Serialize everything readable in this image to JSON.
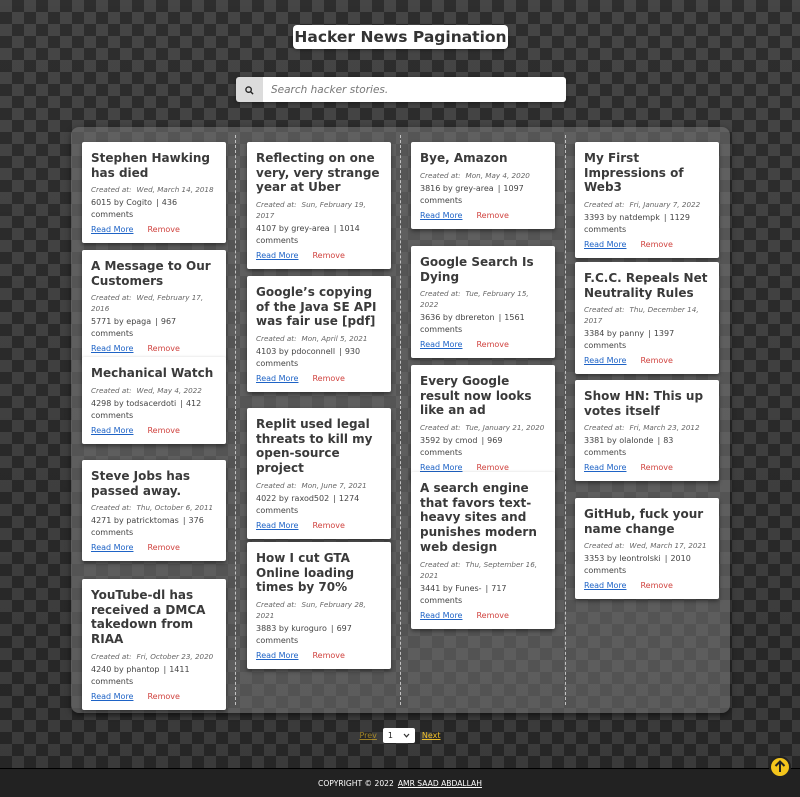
{
  "header": {
    "title": "Hacker News Pagination"
  },
  "search": {
    "placeholder": "Search hacker stories.",
    "icon": "search-icon"
  },
  "labels": {
    "created_at": "Created at:",
    "by": "by",
    "comments": "comments",
    "read_more": "Read More",
    "remove": "Remove"
  },
  "columns": [
    [
      {
        "title": "Stephen Hawking has died",
        "date": "Wed, March 14, 2018",
        "points": "6015",
        "author": "Cogito",
        "comments": "436"
      },
      {
        "title": "A Message to Our Customers",
        "date": "Wed, February 17, 2016",
        "points": "5771",
        "author": "epaga",
        "comments": "967"
      },
      {
        "title": "Mechanical Watch",
        "date": "Wed, May 4, 2022",
        "points": "4298",
        "author": "todsacerdoti",
        "comments": "412"
      },
      {
        "title": "Steve Jobs has passed away.",
        "date": "Thu, October 6, 2011",
        "points": "4271",
        "author": "patricktomas",
        "comments": "376"
      },
      {
        "title": "YouTube-dl has received a DMCA takedown from RIAA",
        "date": "Fri, October 23, 2020",
        "points": "4240",
        "author": "phantop",
        "comments": "1411"
      }
    ],
    [
      {
        "title": "Reflecting on one very, very strange year at Uber",
        "date": "Sun, February 19, 2017",
        "points": "4107",
        "author": "grey-area",
        "comments": "1014"
      },
      {
        "title": "Google’s copying of the Java SE API was fair use [pdf]",
        "date": "Mon, April 5, 2021",
        "points": "4103",
        "author": "pdoconnell",
        "comments": "930"
      },
      {
        "title": "Replit used legal threats to kill my open-source project",
        "date": "Mon, June 7, 2021",
        "points": "4022",
        "author": "raxod502",
        "comments": "1274"
      },
      {
        "title": "How I cut GTA Online loading times by 70%",
        "date": "Sun, February 28, 2021",
        "points": "3883",
        "author": "kuroguro",
        "comments": "697"
      }
    ],
    [
      {
        "title": "Bye, Amazon",
        "date": "Mon, May 4, 2020",
        "points": "3816",
        "author": "grey-area",
        "comments": "1097"
      },
      {
        "title": "Google Search Is Dying",
        "date": "Tue, February 15, 2022",
        "points": "3636",
        "author": "dbrereton",
        "comments": "1561"
      },
      {
        "title": "Every Google result now looks like an ad",
        "date": "Tue, January 21, 2020",
        "points": "3592",
        "author": "cmod",
        "comments": "969"
      },
      {
        "title": "A search engine that favors text-heavy sites and punishes modern web design",
        "date": "Thu, September 16, 2021",
        "points": "3441",
        "author": "Funes-",
        "comments": "717"
      }
    ],
    [
      {
        "title": "My First Impressions of Web3",
        "date": "Fri, January 7, 2022",
        "points": "3393",
        "author": "natdempk",
        "comments": "1129"
      },
      {
        "title": "F.C.C. Repeals Net Neutrality Rules",
        "date": "Thu, December 14, 2017",
        "points": "3384",
        "author": "panny",
        "comments": "1397"
      },
      {
        "title": "Show HN: This up votes itself",
        "date": "Fri, March 23, 2012",
        "points": "3381",
        "author": "olalonde",
        "comments": "83"
      },
      {
        "title": "GitHub, fuck your name change",
        "date": "Wed, March 17, 2021",
        "points": "3353",
        "author": "leontrolski",
        "comments": "2010"
      }
    ]
  ],
  "pagination": {
    "prev": "Prev",
    "current": "1",
    "next": "Next"
  },
  "footer": {
    "copyright": "COPYRIGHT © 2022",
    "author": "AMR SAAD ABDALLAH"
  },
  "colors": {
    "accent": "#f3c51c",
    "link": "#1e63c6",
    "remove": "#d0433f"
  }
}
